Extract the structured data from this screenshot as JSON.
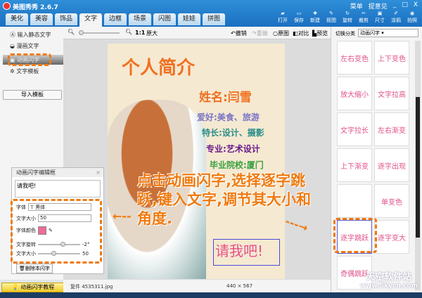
{
  "app": {
    "title": "美图秀秀 2.6.7",
    "menu": "菜单",
    "feedback": "提意见",
    "minimize": "_",
    "maximize": "□",
    "close": "X"
  },
  "tabs": [
    "美化",
    "美容",
    "饰品",
    "文字",
    "边框",
    "场景",
    "闪图",
    "娃娃",
    "拼图"
  ],
  "active_tab": "文字",
  "tools": [
    "打开",
    "保存",
    "新建",
    "抠图",
    "旋转",
    "裁剪",
    "尺寸",
    "涂鸦",
    "拍照"
  ],
  "left": {
    "items": [
      "输入静态文字",
      "漫画文字",
      "动画闪字",
      "文字模板"
    ],
    "import": "导入模板",
    "tutorial": "动画闪字教程"
  },
  "editor": {
    "title": "动画闪字编辑框",
    "text": "请我吧!",
    "font_label": "字体",
    "font_value": "黑体",
    "size_label": "文字大小",
    "size_value": "50",
    "color_label": "字体颜色",
    "color": "#f06a9a",
    "rotate_label": "文字旋转",
    "rotate_value": "-2°",
    "rotate_fraction": 0.6,
    "size2_label": "文字大小",
    "size2_value": "50",
    "size_fraction": 0.35,
    "delete": "删除本闪字"
  },
  "canvasbar": {
    "zoom": "1:1",
    "original_size": "原大",
    "undo": "撤销",
    "redo": "重做",
    "original": "原图",
    "compare": "对比",
    "preview": "预览"
  },
  "poster": {
    "title": "个人简介",
    "name": "姓名:闫雪",
    "hobby": "爱好:美食、旅游",
    "skill": "特长:设计、摄影",
    "major": "专业:艺术设计",
    "school": "毕业院校:厦门",
    "flash_text": "请我吧!"
  },
  "status": {
    "file": "复件 4535311.jpg",
    "dims": "440 × 567"
  },
  "right": {
    "category_label": "切换分类",
    "category_value": "动画闪字",
    "effects": [
      "左右变色",
      "上下变色",
      "放大缩小",
      "文字拉高",
      "文字拉长",
      "左右渐变",
      "上下渐变",
      "逐字出现",
      "",
      "单变色",
      "逐字跳跃",
      "逐字变大",
      "奇偶跳跃"
    ]
  },
  "caption": {
    "line1": "点击动画闪字,选择逐字跳",
    "line2": "跃,键入文字,调节其大小和",
    "line3": "角度."
  },
  "watermark": {
    "line1": "天空软件站",
    "line2": "www.Skycn.com"
  }
}
